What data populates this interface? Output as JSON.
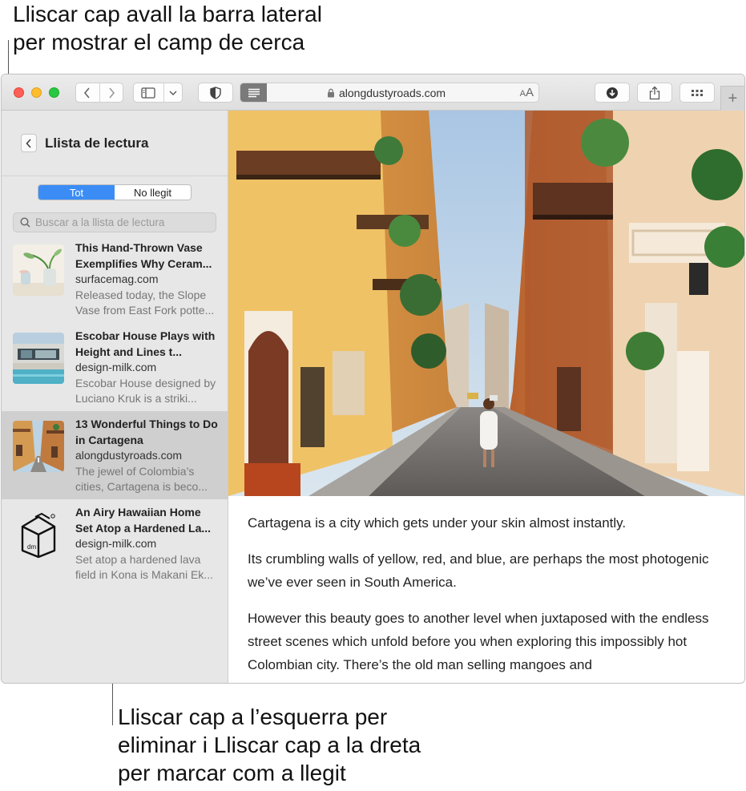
{
  "annotations": {
    "top_line1": "Lliscar cap avall la barra lateral",
    "top_line2": "per mostrar el camp de cerca",
    "bottom_line1": "Lliscar cap a l’esquerra per",
    "bottom_line2": "eliminar i Lliscar cap a la dreta",
    "bottom_line3": "per marcar com a llegit"
  },
  "toolbar": {
    "url": "alongdustyroads.com",
    "text_size_label_small": "A",
    "text_size_label_large": "A",
    "new_tab": "+"
  },
  "sidebar": {
    "title": "Llista de lectura",
    "filters": [
      "Tot",
      "No llegit"
    ],
    "active_filter": "Tot",
    "search_placeholder": "Buscar a la llista de lectura",
    "items": [
      {
        "title": "This Hand-Thrown Vase Exemplifies Why Ceram...",
        "site": "surfacemag.com",
        "description": "Released today, the Slope Vase from East Fork potte..."
      },
      {
        "title": "Escobar House Plays with Height and Lines t...",
        "site": "design-milk.com",
        "description": "Escobar House designed by Luciano Kruk is a striki..."
      },
      {
        "title": "13 Wonderful Things to Do in Cartagena",
        "site": "alongdustyroads.com",
        "description": "The jewel of Colombia’s cities, Cartagena is beco..."
      },
      {
        "title": "An Airy Hawaiian Home Set Atop a Hardened La...",
        "site": "design-milk.com",
        "description": "Set atop a hardened lava field in Kona is Makani Ek..."
      }
    ],
    "selected_index": 2
  },
  "article": {
    "paragraphs": [
      "Cartagena is a city which gets under your skin almost instantly.",
      "Its crumbling walls of yellow, red, and blue, are perhaps the most photogenic we’ve ever seen in South America.",
      "However this beauty goes to another level when juxtaposed with the endless street scenes which unfold before you when exploring this impossibly hot Colombian city. There’s the old man selling mangoes and"
    ]
  },
  "thumb_logo_text": "dm",
  "colors": {
    "accent": "#3b8df5",
    "sidebar_bg": "#e7e7e7",
    "selected_row": "#cfcfcf"
  }
}
